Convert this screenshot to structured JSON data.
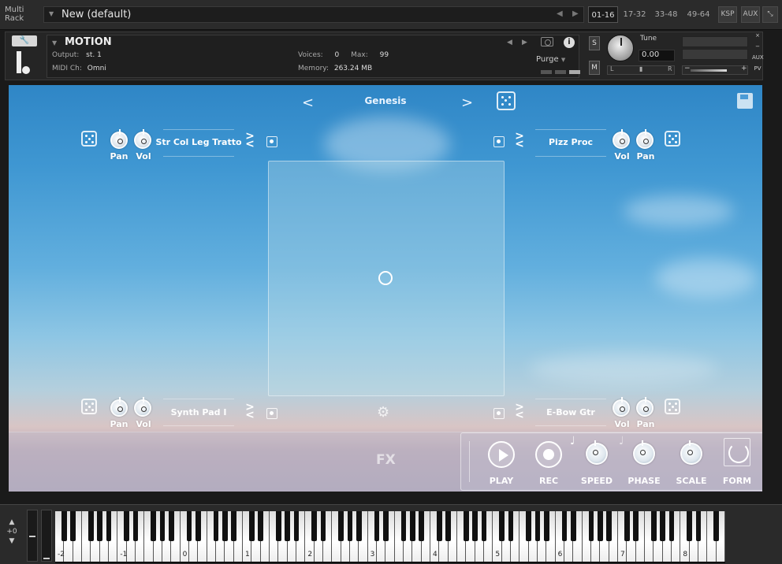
{
  "rack": {
    "title": "Multi\nRack",
    "preset_name": "New (default)",
    "tabs": [
      "01-16",
      "17-32",
      "33-48",
      "49-64"
    ],
    "active_tab": "01-16",
    "ksp_label": "KSP",
    "aux_label": "AUX"
  },
  "instrument": {
    "name": "MOTION",
    "output_label": "Output:",
    "output_value": "st. 1",
    "midi_label": "MIDI Ch:",
    "midi_value": "Omni",
    "voices_label": "Voices:",
    "voices_value": "0",
    "max_label": "Max:",
    "max_value": "99",
    "memory_label": "Memory:",
    "memory_value": "263.24 MB",
    "purge_label": "Purge",
    "solo_label": "S",
    "mute_label": "M",
    "tune_label": "Tune",
    "tune_value": "0.00",
    "pan_left": "L",
    "pan_right": "R",
    "info_label": "i",
    "side_buttons": [
      "×",
      "−",
      "AUX",
      "PV"
    ]
  },
  "panel": {
    "preset_prev": "<",
    "preset_next": ">",
    "preset_name": "Genesis",
    "fx_label": "FX",
    "slots": {
      "top_left": {
        "name": "Str Col Leg Tratto",
        "knob1": "Pan",
        "knob2": "Vol"
      },
      "top_right": {
        "name": "Pizz Proc",
        "knob1": "Vol",
        "knob2": "Pan"
      },
      "bottom_left": {
        "name": "Synth Pad I",
        "knob1": "Pan",
        "knob2": "Vol"
      },
      "bottom_right": {
        "name": "E-Bow Gtr",
        "knob1": "Vol",
        "knob2": "Pan"
      }
    },
    "swap_symbol": ">\n<",
    "transport": {
      "play": "PLAY",
      "rec": "REC",
      "speed": "SPEED",
      "phase": "PHASE",
      "scale": "SCALE",
      "form": "FORM"
    }
  },
  "keyboard": {
    "octave_value": "+0",
    "octave_up": "▲",
    "octave_down": "▼",
    "octave_labels": [
      "-2",
      "-1",
      "0",
      "1",
      "2",
      "3",
      "4",
      "5",
      "6",
      "7",
      "8"
    ]
  },
  "colors": {
    "sky_top": "#2f86c6",
    "sky_bottom": "#d8c5c5",
    "chrome_bg": "#2b2b2b"
  }
}
